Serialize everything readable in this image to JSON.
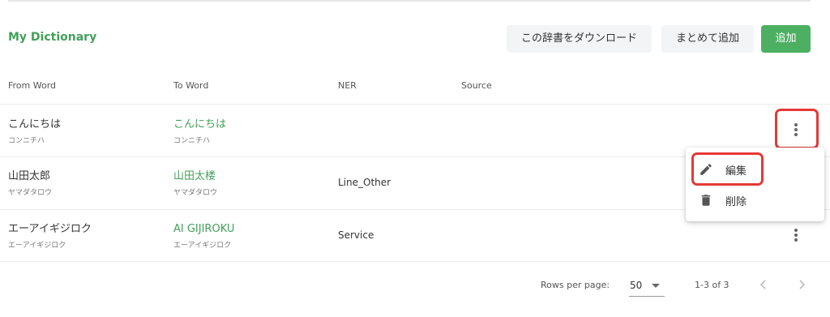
{
  "title": "My Dictionary",
  "toolbar": {
    "download_label": "この辞書をダウンロード",
    "bulk_add_label": "まとめて追加",
    "add_label": "追加"
  },
  "table": {
    "headers": [
      "From Word",
      "To Word",
      "NER",
      "Source"
    ],
    "rows": [
      {
        "from": "こんにちは",
        "from_kana": "コンニチハ",
        "to": "こんにちは",
        "to_kana": "コンニチハ",
        "ner": "",
        "source": ""
      },
      {
        "from": "山田太郎",
        "from_kana": "ヤマダタロウ",
        "to": "山田太楼",
        "to_kana": "ヤマダタロウ",
        "ner": "Line_Other",
        "source": ""
      },
      {
        "from": "エーアイギジロク",
        "from_kana": "エーアイギジロク",
        "to": "AI GIJIROKU",
        "to_kana": "エーアイギジロク",
        "ner": "Service",
        "source": ""
      }
    ]
  },
  "context_menu": {
    "items": [
      {
        "label": "編集",
        "icon": "pencil-icon"
      },
      {
        "label": "削除",
        "icon": "trash-icon"
      }
    ]
  },
  "pagination": {
    "rows_per_page_label": "Rows per page:",
    "rows_per_page_value": "50",
    "range_text": "1-3 of 3"
  },
  "colors": {
    "accent_green": "#43a05a",
    "button_green": "#4caf61",
    "highlight_red": "#e53935"
  }
}
